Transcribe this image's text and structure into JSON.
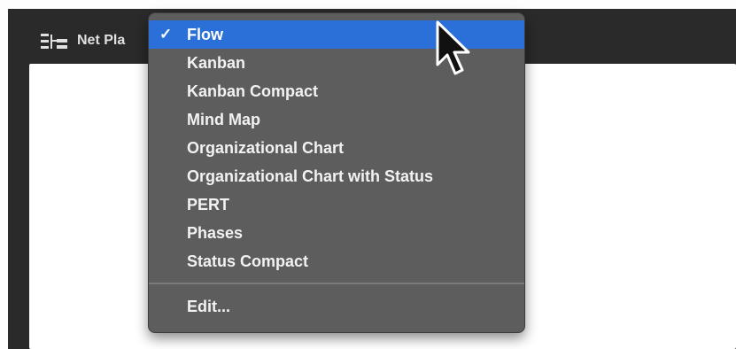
{
  "toolbar": {
    "view_title": "Net Pla",
    "icon": "net-plan-icon"
  },
  "menu": {
    "items": [
      {
        "label": "Flow",
        "selected": true,
        "check": "✓"
      },
      {
        "label": "Kanban"
      },
      {
        "label": "Kanban Compact"
      },
      {
        "label": "Mind Map"
      },
      {
        "label": "Organizational Chart"
      },
      {
        "label": "Organizational Chart with Status"
      },
      {
        "label": "PERT"
      },
      {
        "label": "Phases"
      },
      {
        "label": "Status Compact"
      }
    ],
    "footer_items": [
      {
        "label": "Edit..."
      }
    ]
  },
  "colors": {
    "menu_bg": "#5d5d5d",
    "selection": "#2b6fd8",
    "toolbar_bg": "#2a2a2a",
    "canvas_bg": "#ffffff"
  }
}
